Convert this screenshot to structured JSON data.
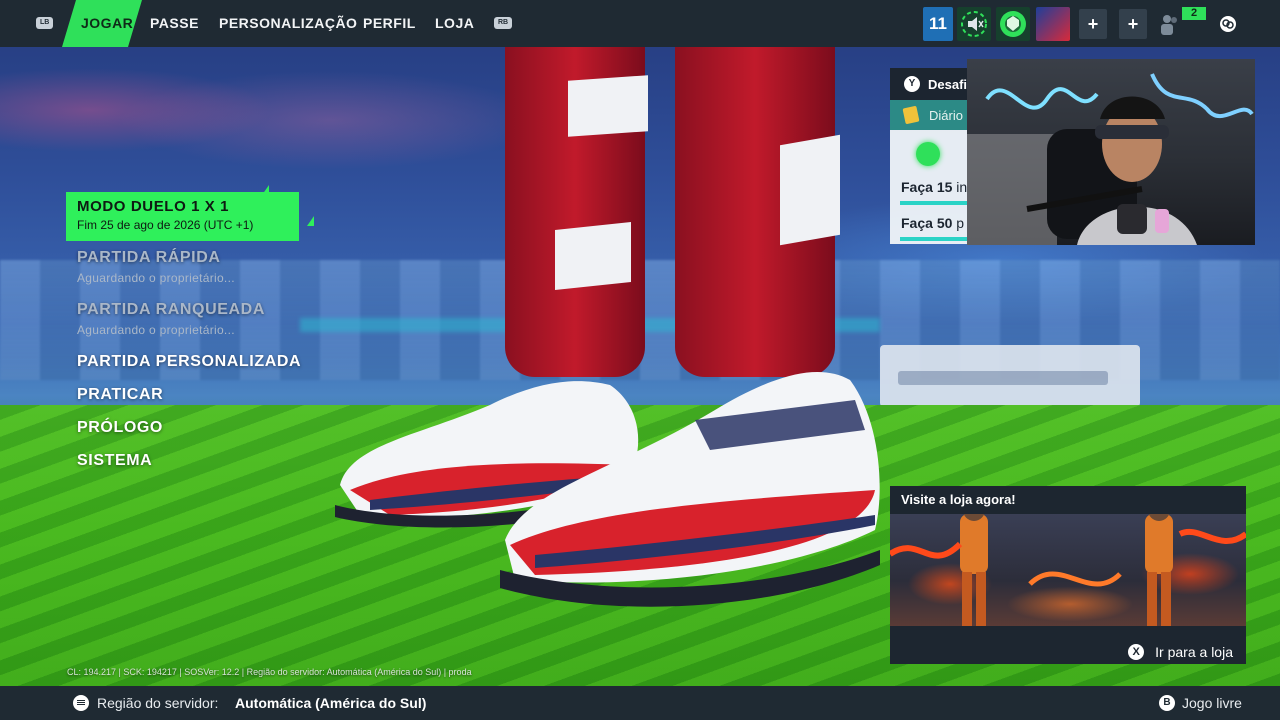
{
  "topbar": {
    "lb_label": "LB",
    "rb_label": "RB",
    "nav": [
      {
        "label": "JOGAR",
        "active": true
      },
      {
        "label": "PASSE",
        "active": false
      },
      {
        "label": "PERSONALIZAÇÃO",
        "active": false
      },
      {
        "label": "PERFIL",
        "active": false
      },
      {
        "label": "LOJA",
        "active": false
      }
    ],
    "level": "11",
    "party_count": "2",
    "add_icon": "+",
    "accent": "#2fe05a"
  },
  "menu": {
    "selected": {
      "title": "MODO DUELO 1 X 1",
      "subtitle": "Fim 25 de ago de 2026 (UTC +1)"
    },
    "quick_match": {
      "label": "PARTIDA RÁPIDA",
      "status": "Aguardando o proprietário..."
    },
    "ranked_match": {
      "label": "PARTIDA RANQUEADA",
      "status": "Aguardando o proprietário..."
    },
    "custom_match": "PARTIDA PERSONALIZADA",
    "practice": "PRATICAR",
    "prologue": "PRÓLOGO",
    "system": "SISTEMA"
  },
  "challenges": {
    "button_glyph": "Y",
    "title": "Desafi",
    "daily": "Diário",
    "row1_prefix": "Faça ",
    "row1_num": "15",
    "row1_suffix": " in",
    "row2_prefix": "Faça ",
    "row2_num": "50",
    "row2_suffix": " p"
  },
  "shop": {
    "title": "Visite a loja agora!",
    "cta_glyph": "X",
    "cta": "Ir para a loja"
  },
  "version_text": "CL: 194.217 | SCK: 194217 | SOSVer: 12.2 | Região do servidor: Automática (América do Sul) | proda",
  "footer": {
    "region_label": "Região do servidor:",
    "region_value": "Automática (América do Sul)",
    "b_glyph": "B",
    "free_play": "Jogo livre"
  }
}
